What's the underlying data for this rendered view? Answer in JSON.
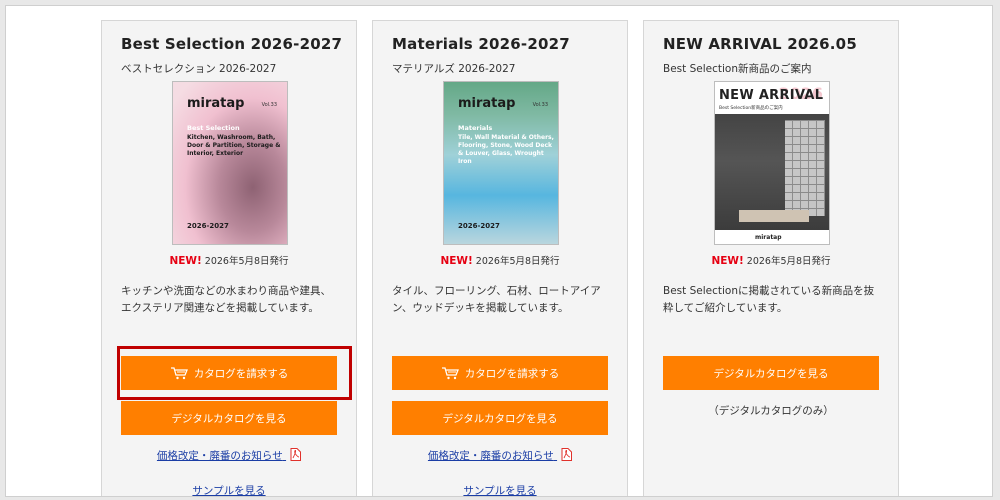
{
  "colors": {
    "accent": "#ff7f00",
    "new": "#e60012",
    "link": "#1a3da5",
    "highlight": "#c00000"
  },
  "cards": [
    {
      "title": "Best Selection 2026-2027",
      "subtitle": "ベストセレクション 2026-2027",
      "cover": {
        "logo": "miratap",
        "vol": "Vol.33",
        "category": "Best Selection",
        "desc": "Kitchen, Washroom, Bath, Door & Partition, Storage & Interior, Exterior",
        "year": "2026-2027"
      },
      "new_label": "NEW!",
      "date": "2026年5月8日発行",
      "description": "キッチンや洗面などの水まわり商品や建具、エクステリア関連などを掲載しています。",
      "request_button": "カタログを請求する",
      "view_button": "デジタルカタログを見る",
      "price_link": "価格改定・廃番のお知らせ",
      "sample_link": "サンプルを見る",
      "icons": {
        "cart": "cart-icon",
        "pdf": "pdf-icon"
      }
    },
    {
      "title": "Materials 2026-2027",
      "subtitle": "マテリアルズ 2026-2027",
      "cover": {
        "logo": "miratap",
        "vol": "Vol.33",
        "category": "Materials",
        "desc": "Tile, Wall Material & Others, Flooring, Stone, Wood Deck & Louver, Glass, Wrought Iron",
        "year": "2026-2027"
      },
      "new_label": "NEW!",
      "date": "2026年5月8日発行",
      "description": "タイル、フローリング、石材、ロートアイアン、ウッドデッキを掲載しています。",
      "request_button": "カタログを請求する",
      "view_button": "デジタルカタログを見る",
      "price_link": "価格改定・廃番のお知らせ",
      "sample_link": "サンプルを見る"
    },
    {
      "title": "NEW ARRIVAL 2026.05",
      "subtitle": "Best Selection新商品のご案内",
      "cover": {
        "heading": "NEW ARRIVAL",
        "year": "2026",
        "sub": "Best Selection新商品のご案内",
        "logo": "miratap"
      },
      "new_label": "NEW!",
      "date": "2026年5月8日発行",
      "description": "Best Selectionに掲載されている新商品を抜粋してご紹介しています。",
      "view_button": "デジタルカタログを見る",
      "note": "（デジタルカタログのみ）"
    }
  ]
}
